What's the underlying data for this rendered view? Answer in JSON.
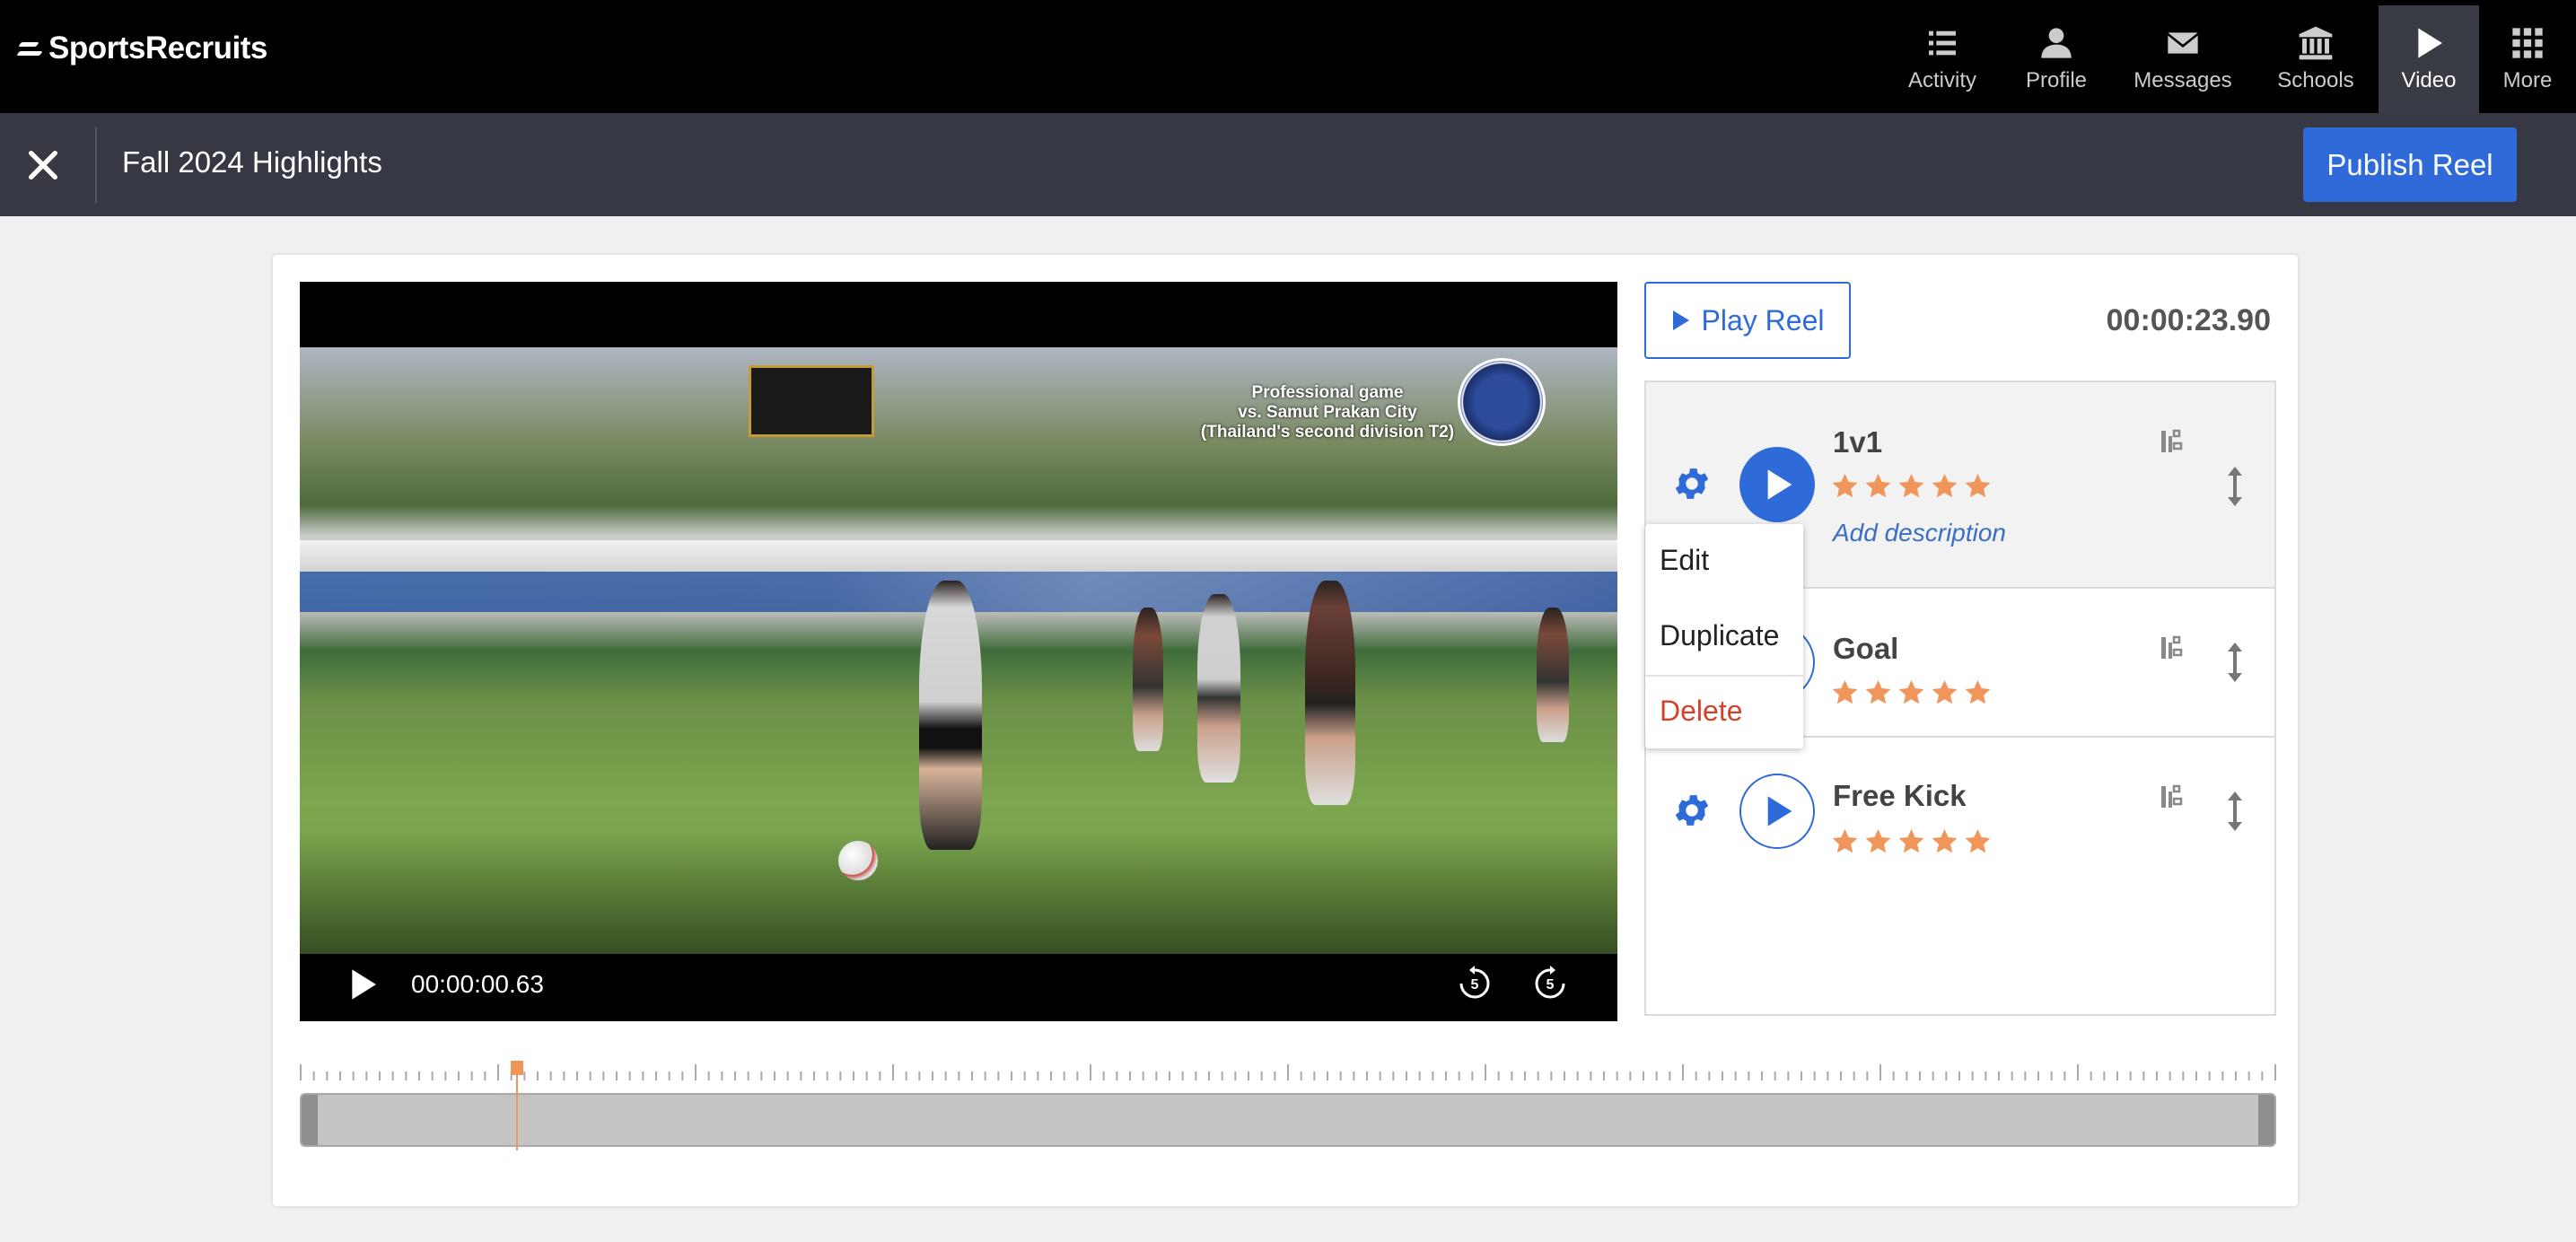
{
  "app": {
    "logo_text": "SportsRecruits"
  },
  "nav": {
    "items": [
      {
        "label": "Activity",
        "icon": "list-icon"
      },
      {
        "label": "Profile",
        "icon": "person-icon"
      },
      {
        "label": "Messages",
        "icon": "envelope-icon"
      },
      {
        "label": "Schools",
        "icon": "bank-icon"
      },
      {
        "label": "Video",
        "icon": "play-icon",
        "active": true
      },
      {
        "label": "More",
        "icon": "grid-icon"
      }
    ]
  },
  "header": {
    "title": "Fall 2024 Highlights",
    "publish_label": "Publish Reel"
  },
  "player": {
    "overlay_line1": "Professional game",
    "overlay_line2": "vs. Samut Prakan City",
    "overlay_line3": "(Thailand's second division T2)",
    "current_time": "00:00:00.63",
    "rewind_seconds": "5",
    "forward_seconds": "5"
  },
  "reel": {
    "play_label": "Play Reel",
    "duration": "00:00:23.90"
  },
  "clips": [
    {
      "title": "1v1",
      "rating": 5,
      "description_placeholder": "Add description"
    },
    {
      "title": "Goal",
      "rating": 5
    },
    {
      "title": "Free Kick",
      "rating": 5
    }
  ],
  "context_menu": {
    "edit": "Edit",
    "duplicate": "Duplicate",
    "delete": "Delete"
  },
  "timeline": {
    "playhead_fraction": 0.11
  },
  "colors": {
    "accent": "#2f6bd8",
    "star": "#f0965a",
    "delete": "#d2432f",
    "playhead": "#f0965a"
  }
}
